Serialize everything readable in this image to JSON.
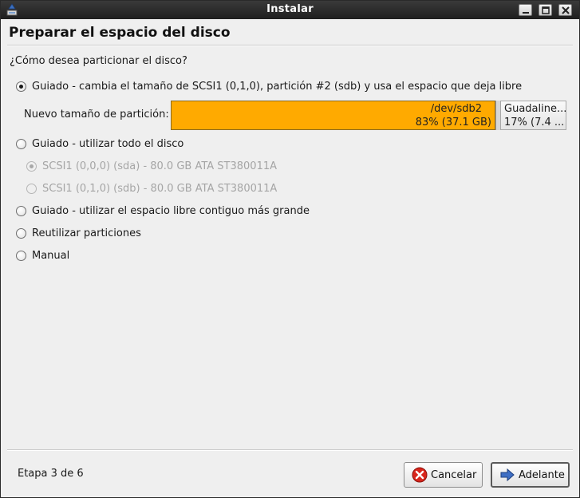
{
  "window": {
    "title": "Instalar",
    "controls": [
      "minimize",
      "maximize",
      "close"
    ]
  },
  "page": {
    "heading": "Preparar el espacio del disco",
    "question": "¿Cómo desea particionar el disco?"
  },
  "options": [
    {
      "label": "Guiado - cambia el tamaño de SCSI1 (0,1,0), partición #2 (sdb) y usa el espacio que deja libre",
      "checked": true,
      "disabled": false
    },
    {
      "label": "Guiado - utilizar todo el disco",
      "checked": false,
      "disabled": false
    },
    {
      "label": "SCSI1 (0,0,0) (sda) - 80.0 GB ATA ST380011A",
      "checked": true,
      "disabled": true
    },
    {
      "label": "SCSI1 (0,1,0) (sdb) - 80.0 GB ATA ST380011A",
      "checked": false,
      "disabled": true
    },
    {
      "label": "Guiado - utilizar el espacio libre contiguo más grande",
      "checked": false,
      "disabled": false
    },
    {
      "label": "Reutilizar particiones",
      "checked": false,
      "disabled": false
    },
    {
      "label": "Manual",
      "checked": false,
      "disabled": false
    }
  ],
  "resize": {
    "label": "Nuevo tamaño de partición:",
    "existing": {
      "name": "/dev/sdb2",
      "size": "83% (37.1 GB)",
      "percent": 83,
      "color": "#ffaa00"
    },
    "new": {
      "name": "Guadaline...",
      "size": "17% (7.4 ...",
      "percent": 17
    }
  },
  "footer": {
    "step": "Etapa 3 de 6",
    "cancel_label": "Cancelar",
    "next_label": "Adelante"
  }
}
